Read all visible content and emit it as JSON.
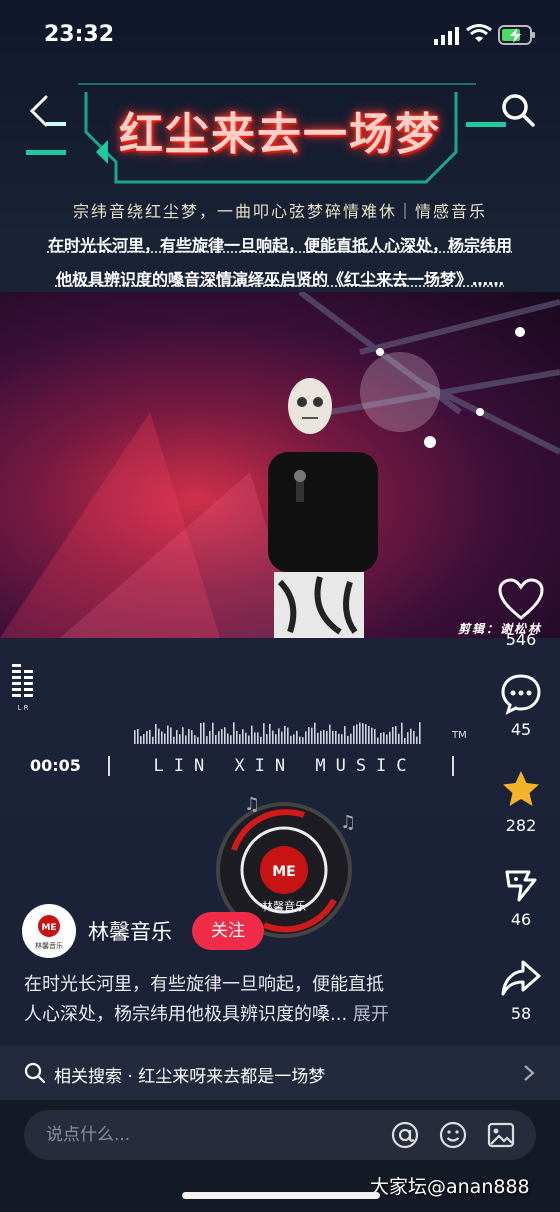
{
  "status_bar": {
    "time": "23:32"
  },
  "header": {
    "title": "红尘来去一场梦",
    "subtitle": "宗纬音绕红尘梦，一曲叩心弦梦碎情难休｜情感音乐",
    "intro_line1": "在时光长河里，有些旋律一旦响起，便能直抵人心深处，杨宗纬用",
    "intro_line2": "他极具辨识度的嗓音深情演绎巫启贤的《红尘来去一场梦》……"
  },
  "video": {
    "editor_credit": "剪辑：谢松林"
  },
  "actions": {
    "likes": "546",
    "comments": "45",
    "favorites": "282",
    "shares_wechat": "46",
    "shares": "58"
  },
  "music_card": {
    "meter_label": "L R",
    "play_time": "00:05",
    "brand": "LIN XIN MUSIC",
    "trademark": "TM",
    "disc_label": "林馨音乐",
    "disc_logo": "ME"
  },
  "author": {
    "name": "林馨音乐",
    "avatar_label": "林馨音乐",
    "follow_label": "关注"
  },
  "description": {
    "line1": "在时光长河里，有些旋律一旦响起，便能直抵",
    "line2": "人心深处，杨宗纬用他极具辨识度的嗓...",
    "expand_label": "展开"
  },
  "related_search": {
    "text": "相关搜索 · 红尘来呀来去都是一场梦"
  },
  "comment_bar": {
    "placeholder": "说点什么..."
  },
  "watermark": "大家坛@anan888",
  "colors": {
    "follow": "#f02c48",
    "star": "#f4b42a",
    "title_glow": "#ff2a1a"
  }
}
